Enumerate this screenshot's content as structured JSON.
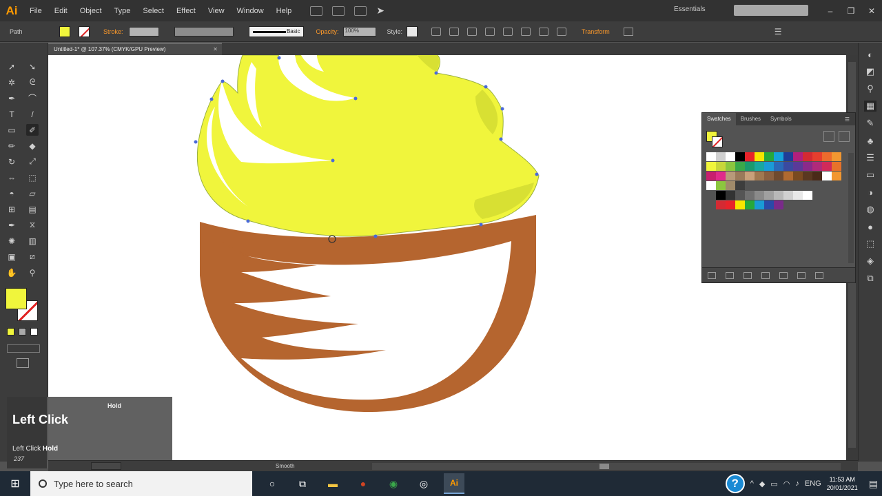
{
  "app": {
    "logo": "Ai"
  },
  "menu": [
    "File",
    "Edit",
    "Object",
    "Type",
    "Select",
    "Effect",
    "View",
    "Window",
    "Help"
  ],
  "workspace": "Essentials",
  "window_buttons": [
    "–",
    "❐",
    "✕"
  ],
  "control": {
    "selection": "Path",
    "stroke_label": "Stroke:",
    "brush_label": "Basic",
    "opacity_label": "Opacity:",
    "opacity_value": "100%",
    "style_label": "Style:",
    "transform_label": "Transform"
  },
  "document_tab": "Untitled-1* @ 107.37% (CMYK/GPU Preview)",
  "toolbar_icons": [
    "selection-tool",
    "direct-selection-tool",
    "magic-wand-tool",
    "lasso-tool",
    "pen-tool",
    "curvature-tool",
    "type-tool",
    "line-tool",
    "rectangle-tool",
    "paintbrush-tool",
    "pencil-tool",
    "eraser-tool",
    "rotate-tool",
    "scale-tool",
    "width-tool",
    "free-transform-tool",
    "shape-builder-tool",
    "perspective-tool",
    "mesh-tool",
    "gradient-tool",
    "eyedropper-tool",
    "blend-tool",
    "symbol-sprayer-tool",
    "graph-tool",
    "artboard-tool",
    "slice-tool",
    "hand-tool",
    "zoom-tool"
  ],
  "swatches_panel": {
    "tabs": [
      "Swatches",
      "Brushes",
      "Symbols"
    ],
    "rows": [
      [
        "#ffffff",
        "#d0d0d0",
        "#ffffff",
        "#000000",
        "#e8232a",
        "#f7e600",
        "#26a83b",
        "#15a3d9",
        "#1f3d96",
        "#b0207c",
        "#d42a33",
        "#e63e2e",
        "#ec6b2d",
        "#f29731"
      ],
      [
        "#f0f53c",
        "#c8d63a",
        "#8cc63f",
        "#3aa84a",
        "#1a9a6e",
        "#18a7a0",
        "#1a9bd6",
        "#2a6ab8",
        "#3a4aa0",
        "#5a3a98",
        "#8a2a8a",
        "#b02a7a",
        "#d02a5a",
        "#e8722a"
      ],
      [
        "#c81f6e",
        "#e02a8a",
        "#b89a7a",
        "#9a7a5a",
        "#c8a07a",
        "#a07850",
        "#8a6040",
        "#704a2e",
        "#b06a30",
        "#7a4a20",
        "#5a3820",
        "#4a2a18",
        "#ffffff",
        "#f29731"
      ],
      [
        "#ffffff",
        "#8cc63f",
        "#a08a6a",
        "#3d3d3d",
        "#535353",
        "#535353",
        "#535353",
        "#535353",
        "#535353",
        "#535353",
        "#535353",
        "#535353",
        "#535353",
        "#535353"
      ],
      [
        "#535353",
        "#000000",
        "#333333",
        "#555555",
        "#707070",
        "#8a8a8a",
        "#a0a0a0",
        "#b8b8b8",
        "#d0d0d0",
        "#e8e8e8",
        "#ffffff",
        "#535353",
        "#535353",
        "#535353"
      ],
      [
        "#535353",
        "#d42a33",
        "#e8232a",
        "#f7e600",
        "#26a83b",
        "#1a9bd6",
        "#2a4aa8",
        "#7a2a8a",
        "#535353",
        "#535353",
        "#535353",
        "#535353",
        "#535353",
        "#535353"
      ]
    ]
  },
  "overlay": {
    "hold": "Hold",
    "left_click": "Left Click",
    "small_text": "Left Click",
    "small_bold": "Hold",
    "tiny": "237"
  },
  "statusbar": {
    "tool": "Smooth"
  },
  "taskbar": {
    "search_placeholder": "Type here to search",
    "lang": "ENG",
    "time": "11:53 AM",
    "date": "20/01/2021"
  },
  "colors": {
    "fill": "#f0f53c",
    "cup": "#b5652f",
    "accent": "#ff9a00"
  }
}
